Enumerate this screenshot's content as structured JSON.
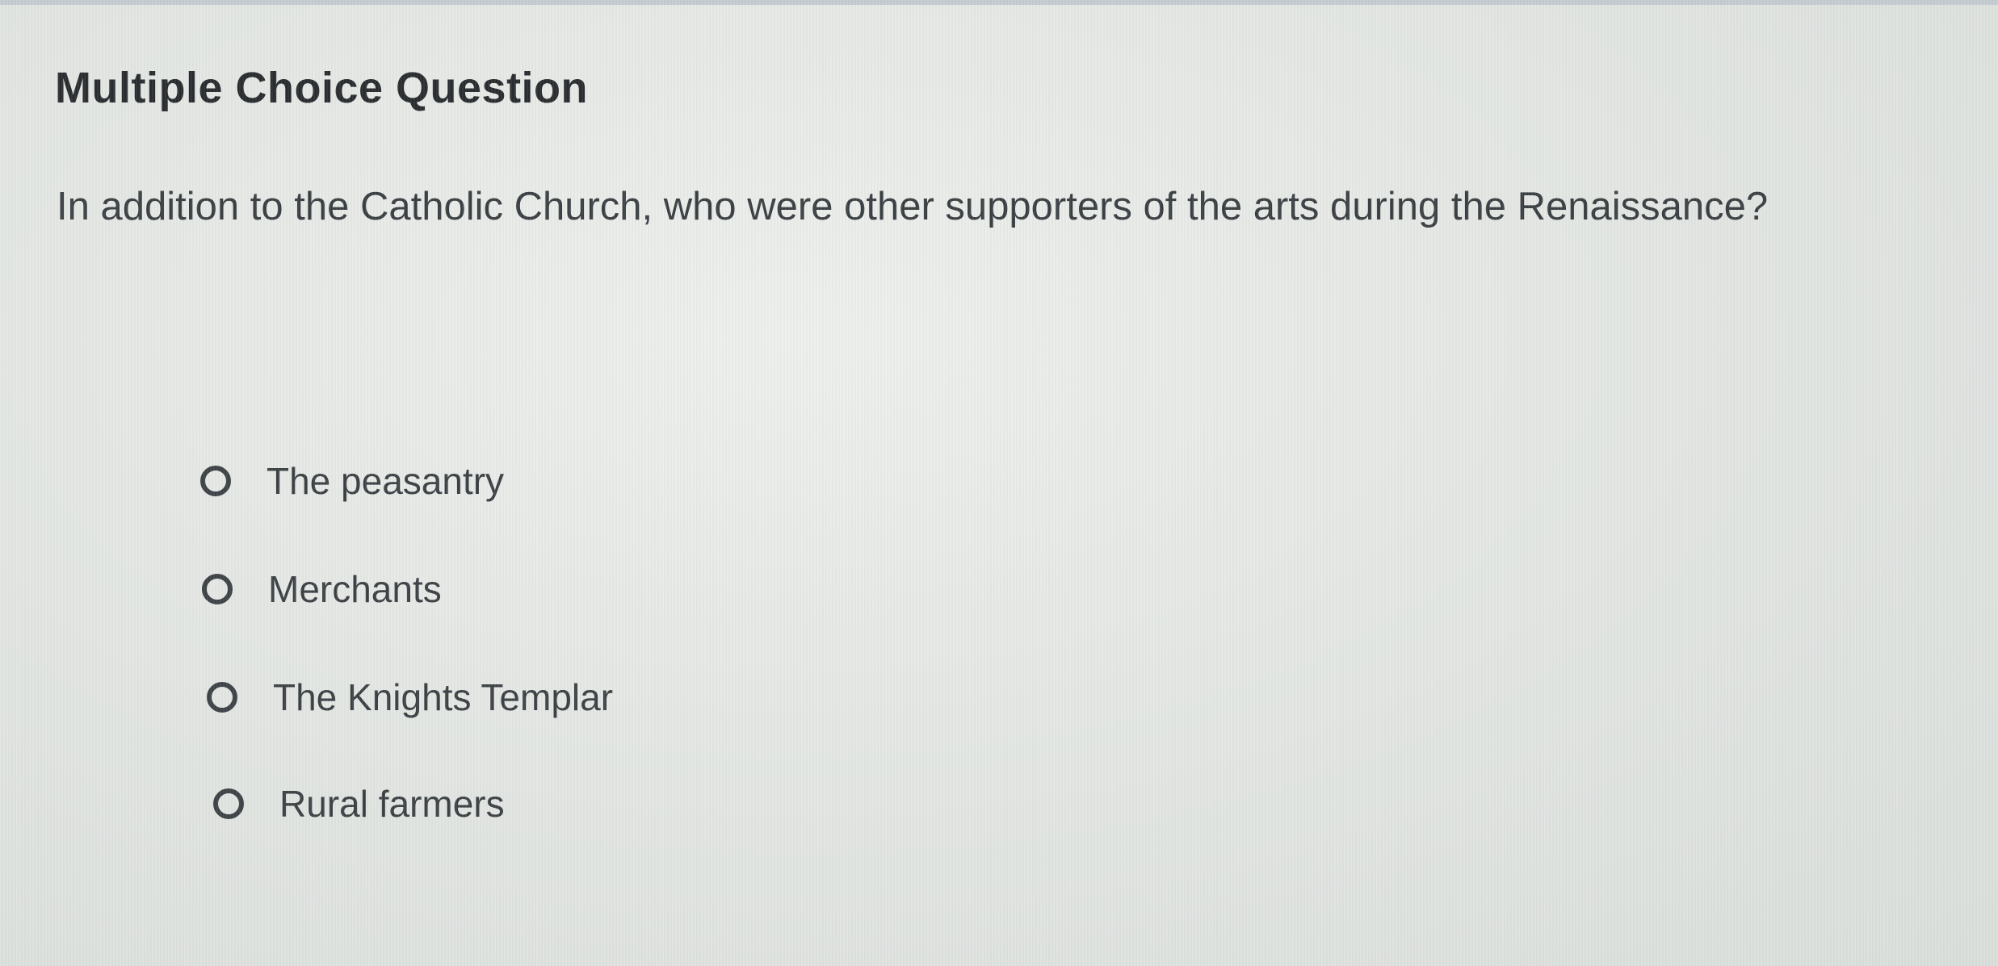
{
  "question": {
    "type_label": "Multiple Choice Question",
    "text": "In addition to the Catholic Church, who were other supporters of the arts during the Renaissance?",
    "options": [
      {
        "label": "The peasantry",
        "selected": false
      },
      {
        "label": "Merchants",
        "selected": false
      },
      {
        "label": "The Knights Templar",
        "selected": false
      },
      {
        "label": "Rural farmers",
        "selected": false
      }
    ]
  },
  "colors": {
    "background": "#e4e7e4",
    "heading": "#2a2d2f",
    "body_text": "#3a3f43",
    "radio_border": "#3d4347"
  }
}
